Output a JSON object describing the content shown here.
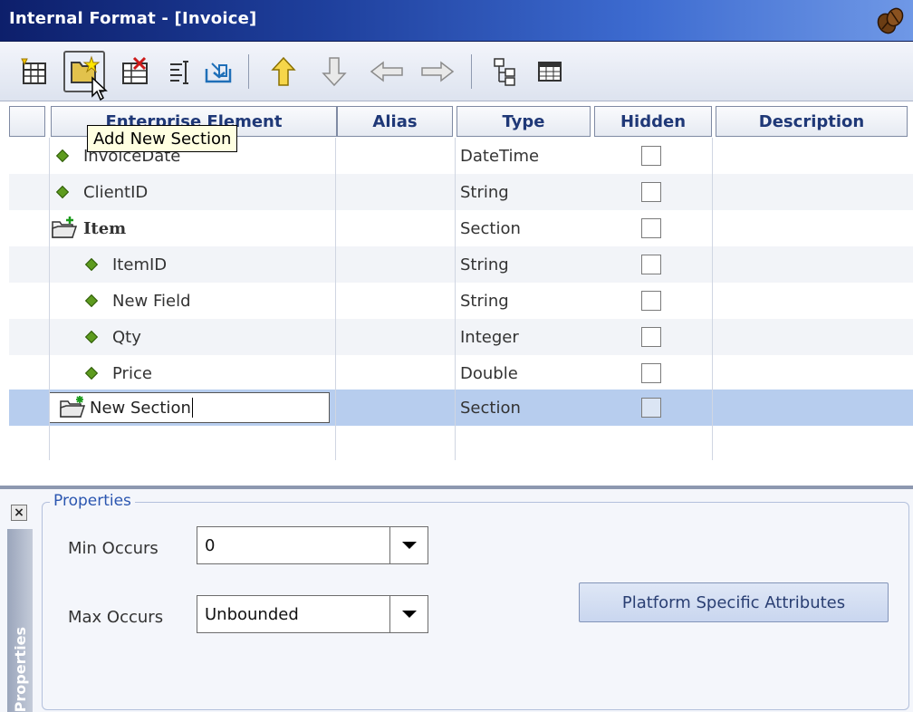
{
  "window": {
    "title": "Internal Format - [Invoice]",
    "logo_icon": "coffee-bean-icon"
  },
  "toolbar": {
    "buttons": [
      {
        "icon": "add-field-icon"
      },
      {
        "icon": "add-section-icon"
      },
      {
        "icon": "delete-icon"
      },
      {
        "icon": "properties-icon"
      },
      {
        "icon": "import-icon"
      },
      {
        "icon": "move-up-icon"
      },
      {
        "icon": "move-down-icon"
      },
      {
        "icon": "move-left-icon"
      },
      {
        "icon": "move-right-icon"
      },
      {
        "icon": "tree-view-icon"
      },
      {
        "icon": "grid-view-icon"
      }
    ],
    "tooltip": "Add New Section"
  },
  "grid": {
    "columns": [
      "Enterprise Element",
      "Alias",
      "Type",
      "Hidden",
      "Description"
    ],
    "rows": [
      {
        "name": "InvoiceDate",
        "type": "DateTime",
        "kind": "field",
        "indent": 0
      },
      {
        "name": "ClientID",
        "type": "String",
        "kind": "field",
        "indent": 0
      },
      {
        "name": "Item",
        "type": "Section",
        "kind": "section",
        "indent": 0
      },
      {
        "name": "ItemID",
        "type": "String",
        "kind": "field",
        "indent": 1
      },
      {
        "name": "New Field",
        "type": "String",
        "kind": "field",
        "indent": 1
      },
      {
        "name": "Qty",
        "type": "Integer",
        "kind": "field",
        "indent": 1
      },
      {
        "name": "Price",
        "type": "Double",
        "kind": "field",
        "indent": 1
      },
      {
        "name": "New Section",
        "type": "Section",
        "kind": "section-new",
        "indent": 0,
        "editing": true
      }
    ]
  },
  "properties": {
    "panel_label": "Properties",
    "legend": "Properties",
    "min_occurs": {
      "label": "Min Occurs",
      "value": "0"
    },
    "max_occurs": {
      "label": "Max Occurs",
      "value": "Unbounded"
    },
    "platform_button": "Platform Specific Attributes",
    "close_icon": "close-icon"
  },
  "colors": {
    "title_bar": "#1e3f9c",
    "selected_row": "#b7cdee",
    "header_text": "#1f3877",
    "legend_text": "#2b56b0"
  }
}
